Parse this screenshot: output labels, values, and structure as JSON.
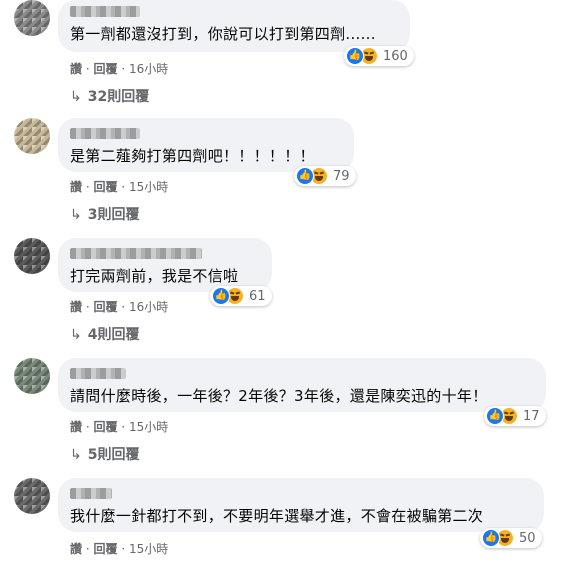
{
  "comments": [
    {
      "text": "第一劑都還沒打到，你說可以打到第四劑......",
      "reactions": "160",
      "like": "讚",
      "reply": "回覆",
      "time": "16小時",
      "replies": "32則回覆"
    },
    {
      "text": "是第二薤夠打第四劑吧！！！！！！",
      "reactions": "79",
      "like": "讚",
      "reply": "回覆",
      "time": "15小時",
      "replies": "3則回覆"
    },
    {
      "text": "打完兩劑前，我是不信啦",
      "reactions": "61",
      "like": "讚",
      "reply": "回覆",
      "time": "16小時",
      "replies": "4則回覆"
    },
    {
      "text": "請問什麼時後，一年後？2年後？3年後，還是陳奕迅的十年！",
      "reactions": "17",
      "like": "讚",
      "reply": "回覆",
      "time": "15小時",
      "replies": "5則回覆"
    },
    {
      "text": "我什麼一針都打不到，不要明年選舉才進，不會在被騙第二次",
      "reactions": "50",
      "like": "讚",
      "reply": "回覆",
      "time": "15小時"
    }
  ],
  "separator": "·",
  "reply_arrow": "↳",
  "icons": {
    "like": "like-icon",
    "haha": "haha-icon"
  },
  "colors": {
    "bubble": "#f0f2f5",
    "meta": "#65676b",
    "like": "#1877f2",
    "haha": "#f7b125"
  }
}
